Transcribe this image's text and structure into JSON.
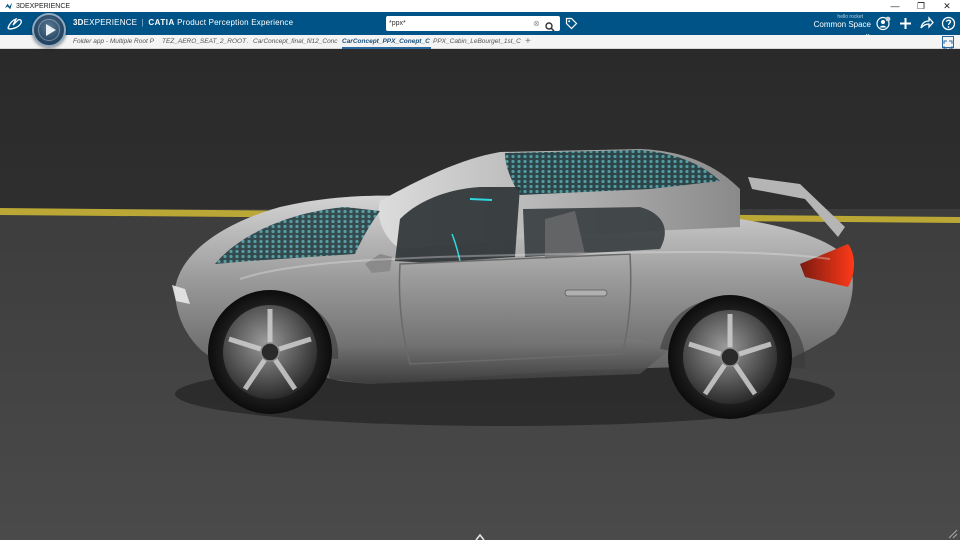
{
  "window": {
    "title": "3DEXPERIENCE",
    "controls": {
      "minimize": "—",
      "restore": "❐",
      "close": "✕"
    }
  },
  "header": {
    "brand_3d": "3D",
    "brand_experience": "EXPERIENCE",
    "brand_separator": "|",
    "brand_catia": "CATIA",
    "app_name": "Product Perception Experience",
    "search_value": "*ppx*",
    "search_clear": "⊗",
    "user_greeting": "hello rocket",
    "space_name": "Common Space ⌄",
    "icons": [
      "ds-logo-icon",
      "compass-icon",
      "search-icon",
      "tag-icon",
      "user-icon",
      "add-icon",
      "share-icon",
      "help-icon"
    ],
    "accent_color": "#005386"
  },
  "tabs": {
    "items": [
      {
        "label": "Folder app - Multiple Root P",
        "active": false
      },
      {
        "label": "TEZ_AERO_SEAT_2_ROOT A",
        "active": false
      },
      {
        "label": "CarConcept_final_fil12_Conc",
        "active": false
      },
      {
        "label": "CarConcept_PPX_Conept_C",
        "active": true
      },
      {
        "label": "PPX_Cabin_LeBourget_1st_C",
        "active": false
      }
    ],
    "add_label": "+"
  },
  "viewport": {
    "content": "3D car concept render",
    "colors": {
      "road": "#3a3a3a",
      "sky": "#2e2e2e",
      "road_line": "#c8b234",
      "car_body": "#9a9a9a",
      "tail_light": "#e02810",
      "accent_glow": "#2fd8e0"
    }
  }
}
